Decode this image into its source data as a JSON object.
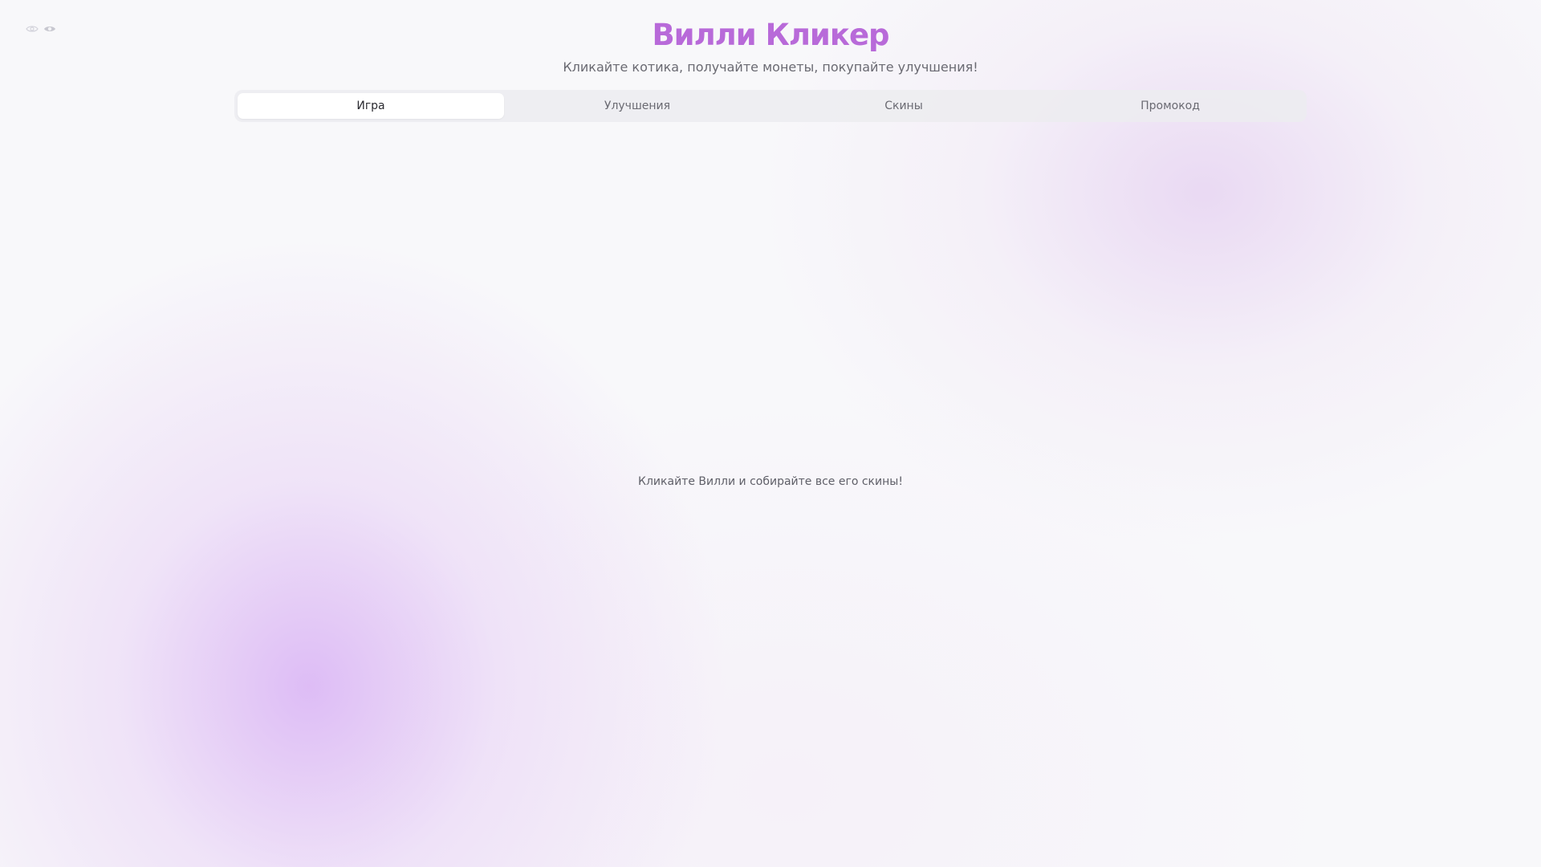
{
  "app": {
    "title": "Вилли Кликер",
    "subtitle": "Кликайте котика, получайте монеты, покупайте улучшения!"
  },
  "top_left_controls": {
    "icons": [
      "eye-outline-icon",
      "eye-filled-icon"
    ]
  },
  "tabs": [
    {
      "label": "Игра",
      "active": true
    },
    {
      "label": "Улучшения",
      "active": false
    },
    {
      "label": "Скины",
      "active": false
    },
    {
      "label": "Промокод",
      "active": false
    }
  ],
  "main": {
    "hint": "Кликайте Вилли и собирайте все его скины!"
  },
  "colors": {
    "accent": "#b86ad9",
    "background": "#f8f8fa",
    "muted_text": "#6a6a72"
  }
}
